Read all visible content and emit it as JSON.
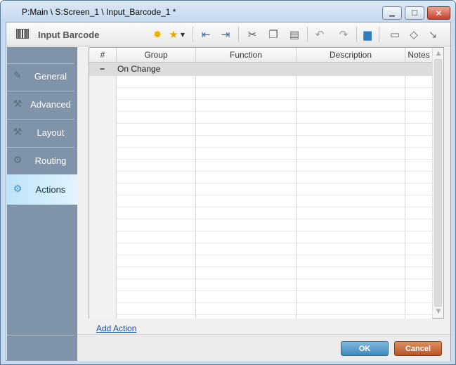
{
  "window": {
    "title": "P:Main \\ S:Screen_1 \\ Input_Barcode_1 *"
  },
  "toolbar": {
    "title": "Input Barcode"
  },
  "sidebar": {
    "items": [
      {
        "label": "General",
        "icon": "pencil-icon",
        "active": false
      },
      {
        "label": "Advanced",
        "icon": "wrench-icon",
        "active": false
      },
      {
        "label": "Layout",
        "icon": "wrench-icon",
        "active": false
      },
      {
        "label": "Routing",
        "icon": "gear-icon",
        "active": false
      },
      {
        "label": "Actions",
        "icon": "gears-icon",
        "active": true
      }
    ]
  },
  "grid": {
    "columns": [
      "#",
      "Group",
      "Function",
      "Description",
      "Notes"
    ],
    "group_row": {
      "expander": "−",
      "label": "On Change"
    }
  },
  "links": {
    "add_action": "Add Action"
  },
  "buttons": {
    "ok": "OK",
    "cancel": "Cancel"
  },
  "colors": {
    "ok": "#4a95c6",
    "cancel": "#c5632f",
    "sidebar": "#7f94a8",
    "active_tab": "#cdebfa"
  }
}
